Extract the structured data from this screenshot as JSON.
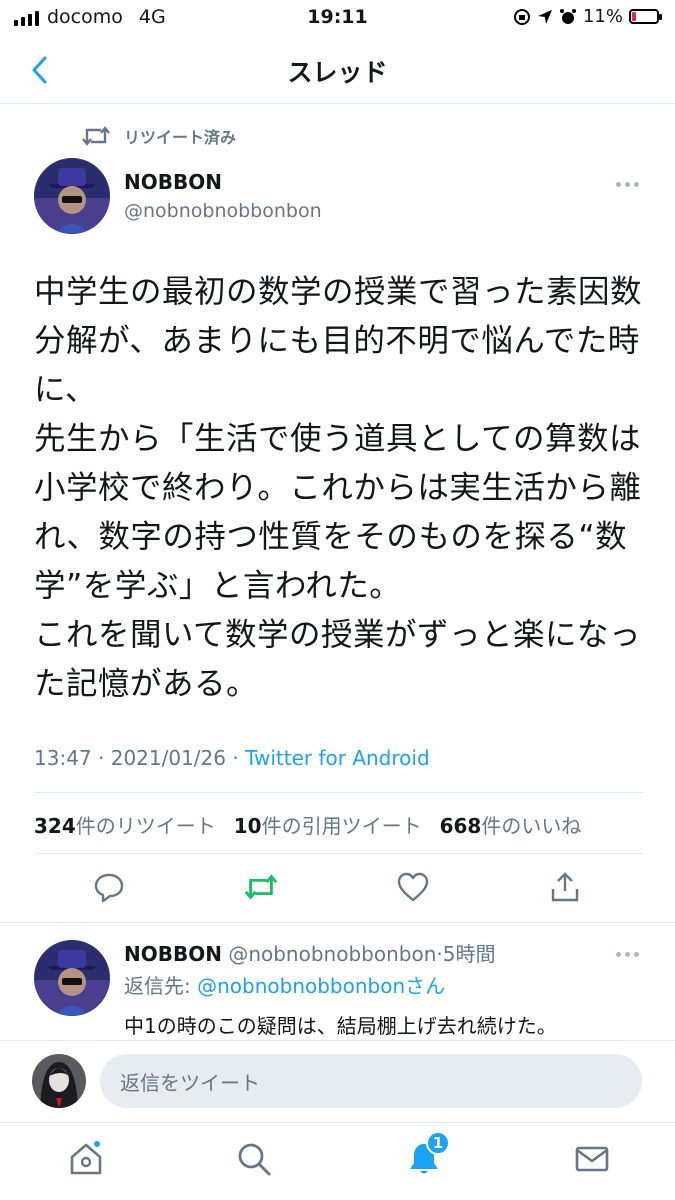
{
  "status_bar": {
    "carrier": "docomo",
    "network": "4G",
    "time": "19:11",
    "battery": "11%"
  },
  "header": {
    "title": "スレッド"
  },
  "retweet_label": "リツイート済み",
  "tweet": {
    "author_name": "NOBBON",
    "author_handle": "@nobnobnobbonbon",
    "text_lines": [
      "中学生の最初の数学の授業で習った素因数",
      "分解が、あまりにも目的不明で悩んでた時",
      "に、",
      "先生から「生活で使う道具としての算数は",
      "小学校で終わり。これからは実生活から離",
      "れ、数字の持つ性質をそのものを探る“数",
      "学”を学ぶ」と言われた。",
      "これを聞いて数学の授業がずっと楽になっ",
      "た記憶がある。"
    ],
    "time": "13:47",
    "date": "2021/01/26",
    "client": "Twitter for Android",
    "retweets": "324",
    "retweets_label": "件のリツイート",
    "quotes": "10",
    "quotes_label": "件の引用ツイート",
    "likes": "668",
    "likes_label": "件のいいね"
  },
  "reply": {
    "author_name": "NOBBON",
    "author_handle": "@nobnobnobbonbon",
    "age": "5時間",
    "reply_to_prefix": "返信先:",
    "reply_to_handle": "@nobnobnobbonbon",
    "reply_to_suffix": "さん",
    "text": "中1の時のこの疑問は、結局棚上げ去れ続けた。"
  },
  "compose": {
    "placeholder": "返信をツイート"
  },
  "tabbar": {
    "notifications_badge": "1"
  },
  "colors": {
    "accent": "#1da1f2",
    "retweet_active": "#17bf63",
    "secondary_text": "#657786"
  },
  "icons": [
    "back-chevron-icon",
    "retweet-icon",
    "more-icon",
    "reply-icon",
    "like-icon",
    "share-icon",
    "home-icon",
    "search-icon",
    "bell-icon",
    "mail-icon"
  ]
}
